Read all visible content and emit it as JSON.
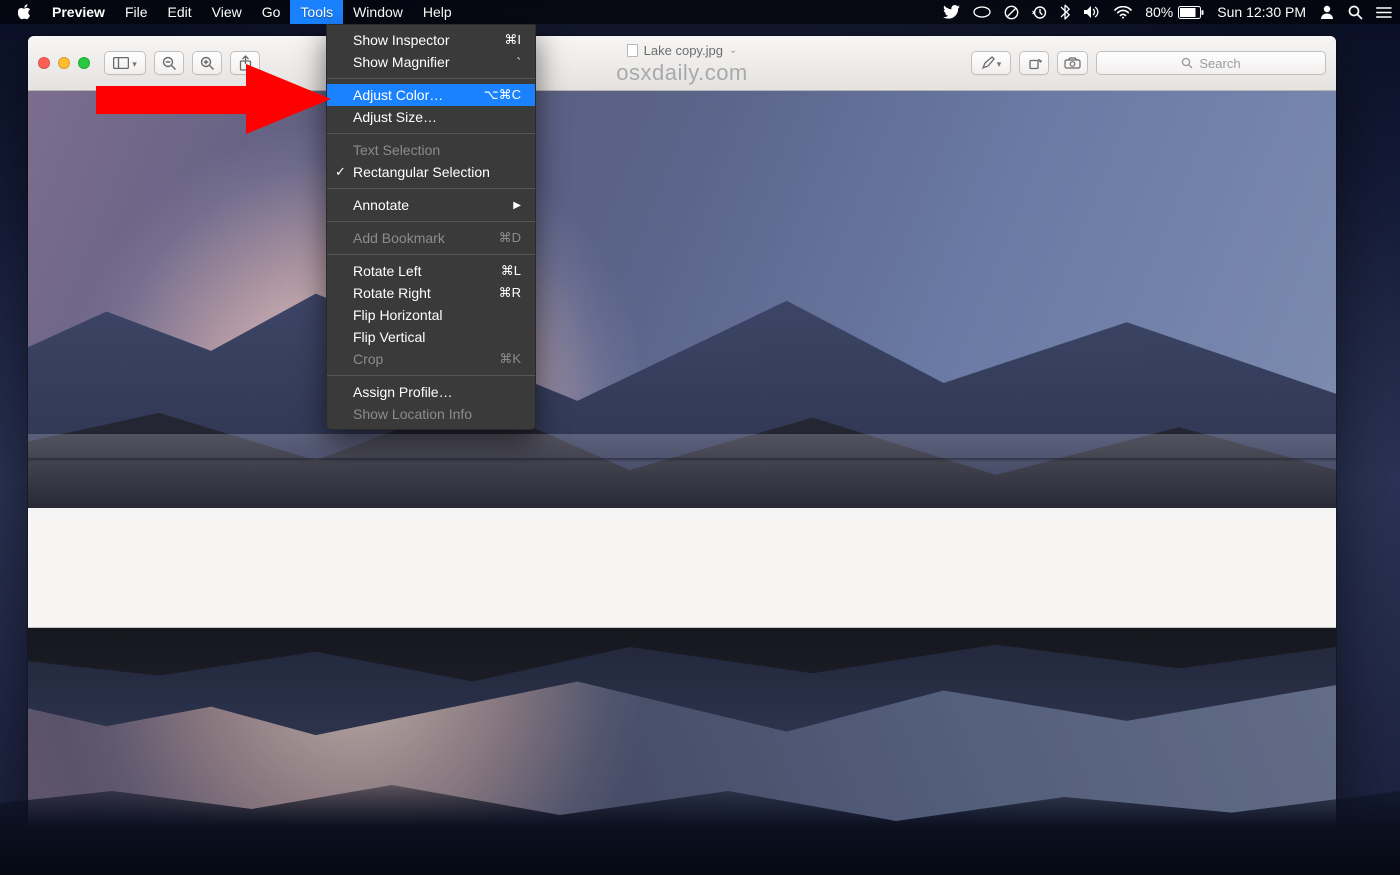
{
  "menubar": {
    "app_name": "Preview",
    "items": [
      "File",
      "Edit",
      "View",
      "Go",
      "Tools",
      "Window",
      "Help"
    ],
    "active": "Tools",
    "status": {
      "battery_percent": "80%",
      "clock": "Sun 12:30 PM"
    }
  },
  "window": {
    "filename": "Lake copy.jpg",
    "watermark": "osxdaily.com",
    "search_placeholder": "Search"
  },
  "dropdown": {
    "groups": [
      [
        {
          "label": "Show Inspector",
          "shortcut": "⌘I"
        },
        {
          "label": "Show Magnifier",
          "shortcut": "`"
        }
      ],
      [
        {
          "label": "Adjust Color…",
          "shortcut": "⌥⌘C",
          "highlighted": true
        },
        {
          "label": "Adjust Size…"
        }
      ],
      [
        {
          "label": "Text Selection",
          "disabled": true
        },
        {
          "label": "Rectangular Selection",
          "checked": true
        }
      ],
      [
        {
          "label": "Annotate",
          "submenu": true
        }
      ],
      [
        {
          "label": "Add Bookmark",
          "shortcut": "⌘D",
          "disabled": true
        }
      ],
      [
        {
          "label": "Rotate Left",
          "shortcut": "⌘L"
        },
        {
          "label": "Rotate Right",
          "shortcut": "⌘R"
        },
        {
          "label": "Flip Horizontal"
        },
        {
          "label": "Flip Vertical"
        },
        {
          "label": "Crop",
          "shortcut": "⌘K",
          "disabled": true
        }
      ],
      [
        {
          "label": "Assign Profile…"
        },
        {
          "label": "Show Location Info",
          "disabled": true
        }
      ]
    ]
  },
  "annotation": {
    "arrow_color": "#ff0000"
  }
}
